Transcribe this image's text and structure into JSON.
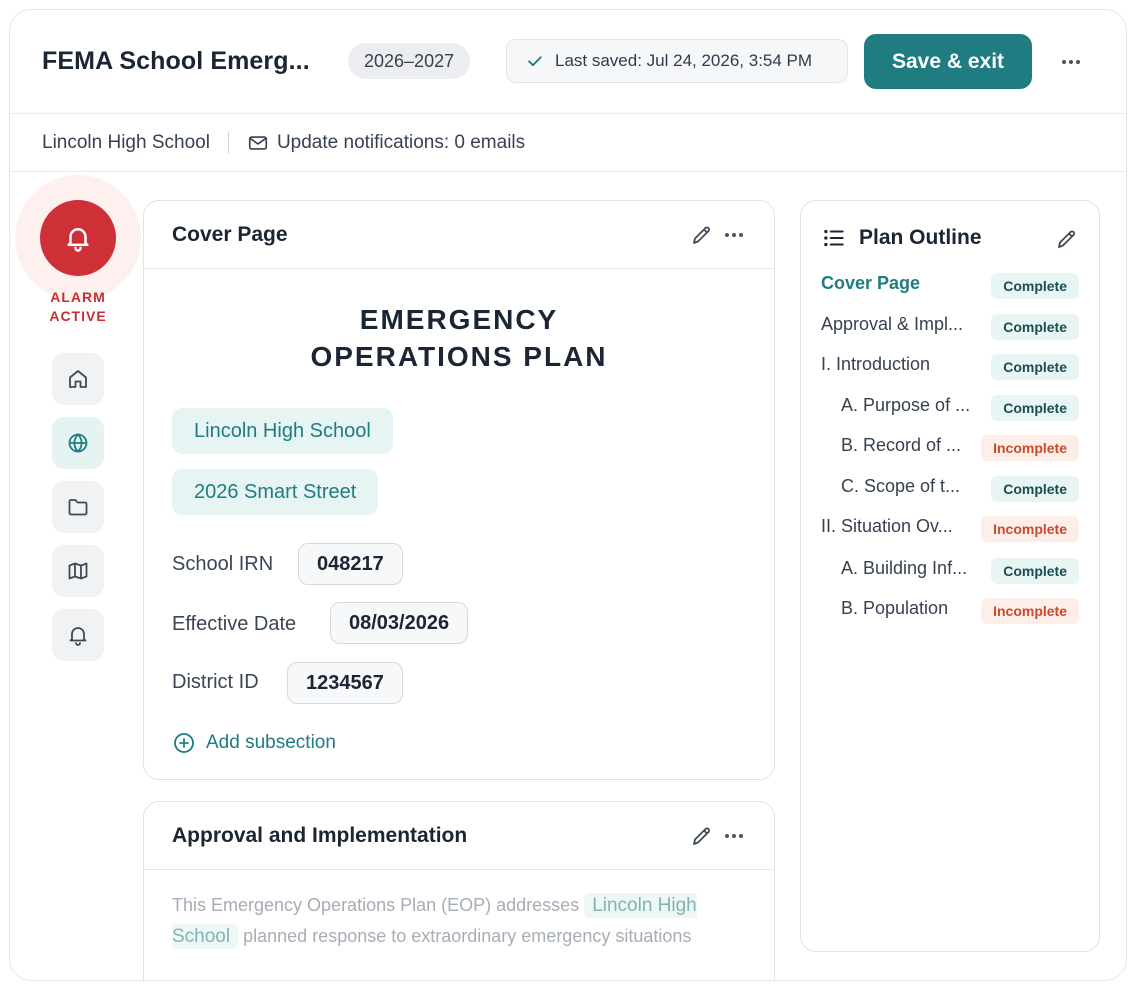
{
  "header": {
    "title": "FEMA School Emerg...",
    "year": "2026–2027",
    "saved": "Last saved: Jul 24, 2026, 3:54 PM",
    "save_label": "Save & exit"
  },
  "subbar": {
    "school": "Lincoln High School",
    "notifications": "Update notifications: 0 emails"
  },
  "rail": {
    "alarm_line1": "ALARM",
    "alarm_line2": "ACTIVE",
    "icons": [
      "home-icon",
      "globe-icon",
      "folder-icon",
      "map-icon",
      "bell-icon"
    ],
    "active": "globe-icon"
  },
  "cover": {
    "title": "Cover Page",
    "heading_line1": "EMERGENCY",
    "heading_line2": "OPERATIONS PLAN",
    "school_chip": "Lincoln High School",
    "address_chip": "2026 Smart Street",
    "irn_label": "School IRN",
    "irn_value": "048217",
    "date_label": "Effective Date",
    "date_value": "08/03/2026",
    "district_label": "District ID",
    "district_value": "1234567",
    "add_label": "Add subsection"
  },
  "approval": {
    "title": "Approval and Implementation",
    "text_before": "This Emergency Operations Plan (EOP) addresses",
    "highlight": "Lincoln High School",
    "text_after": "planned response to extraordinary emergency situations"
  },
  "outline": {
    "title": "Plan Outline",
    "items": [
      {
        "label": "Cover Page",
        "status": "Complete"
      },
      {
        "label": "Approval & Impl...",
        "status": "Complete"
      },
      {
        "label": "I. Introduction",
        "status": "Complete"
      },
      {
        "label": "A. Purpose of ...",
        "status": "Complete"
      },
      {
        "label": "B. Record of ...",
        "status": "Incomplete"
      },
      {
        "label": "C. Scope of t...",
        "status": "Complete"
      },
      {
        "label": "II. Situation Ov...",
        "status": "Incomplete"
      },
      {
        "label": "A. Building Inf...",
        "status": "Complete"
      },
      {
        "label": "B. Population",
        "status": "Incomplete"
      }
    ]
  },
  "colors": {
    "accent": "#1f7c80",
    "alarm": "#cf2f36",
    "complete_bg": "#e8f5f5",
    "incomplete_bg": "#fdeeea",
    "incomplete_text": "#c94a2c"
  }
}
